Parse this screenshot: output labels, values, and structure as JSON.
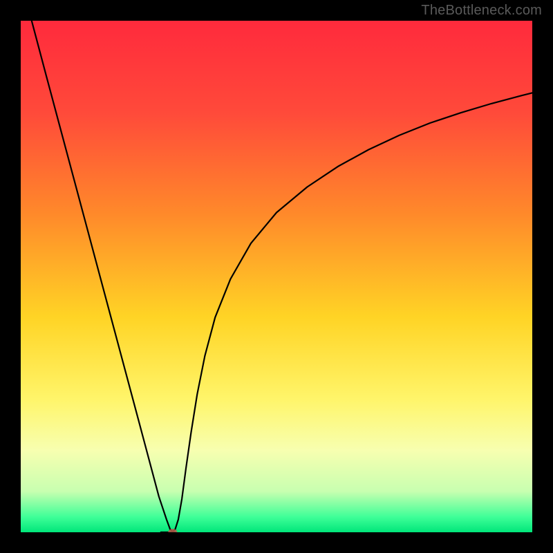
{
  "watermark": "TheBottleneck.com",
  "chart_data": {
    "type": "line",
    "title": "",
    "xlabel": "",
    "ylabel": "",
    "xlim": [
      0,
      100
    ],
    "ylim": [
      0,
      100
    ],
    "gradient_stops": [
      {
        "offset": 0,
        "color": "#ff2a3c"
      },
      {
        "offset": 18,
        "color": "#ff4a3a"
      },
      {
        "offset": 38,
        "color": "#ff8a2a"
      },
      {
        "offset": 58,
        "color": "#ffd425"
      },
      {
        "offset": 74,
        "color": "#fff56a"
      },
      {
        "offset": 84,
        "color": "#f7ffb0"
      },
      {
        "offset": 92,
        "color": "#c8ffb0"
      },
      {
        "offset": 97,
        "color": "#3fff98"
      },
      {
        "offset": 100,
        "color": "#00e67a"
      }
    ],
    "series": [
      {
        "name": "bottleneck-curve",
        "x": [
          0,
          2,
          5,
          8,
          11,
          14,
          17,
          20,
          23,
          25,
          27,
          28.5,
          29.2,
          29.7,
          30.2,
          30.8,
          31.5,
          32.3,
          33.3,
          34.5,
          36,
          38,
          41,
          45,
          50,
          56,
          62,
          68,
          74,
          80,
          86,
          92,
          98,
          100
        ],
        "y": [
          108,
          100.5,
          89.2,
          78,
          66.8,
          55.6,
          44.4,
          33.2,
          22,
          14.5,
          7,
          2.5,
          0.6,
          0.1,
          0.6,
          2.5,
          6.5,
          12.5,
          19.5,
          27,
          34.5,
          42,
          49.5,
          56.5,
          62.5,
          67.5,
          71.5,
          74.8,
          77.6,
          80,
          82,
          83.8,
          85.4,
          85.9
        ]
      }
    ],
    "minimum_marker": {
      "x": 29.7,
      "y": 0.0
    },
    "flat_segment": {
      "x0": 27.4,
      "x1": 30.2,
      "y": 0.0
    }
  }
}
